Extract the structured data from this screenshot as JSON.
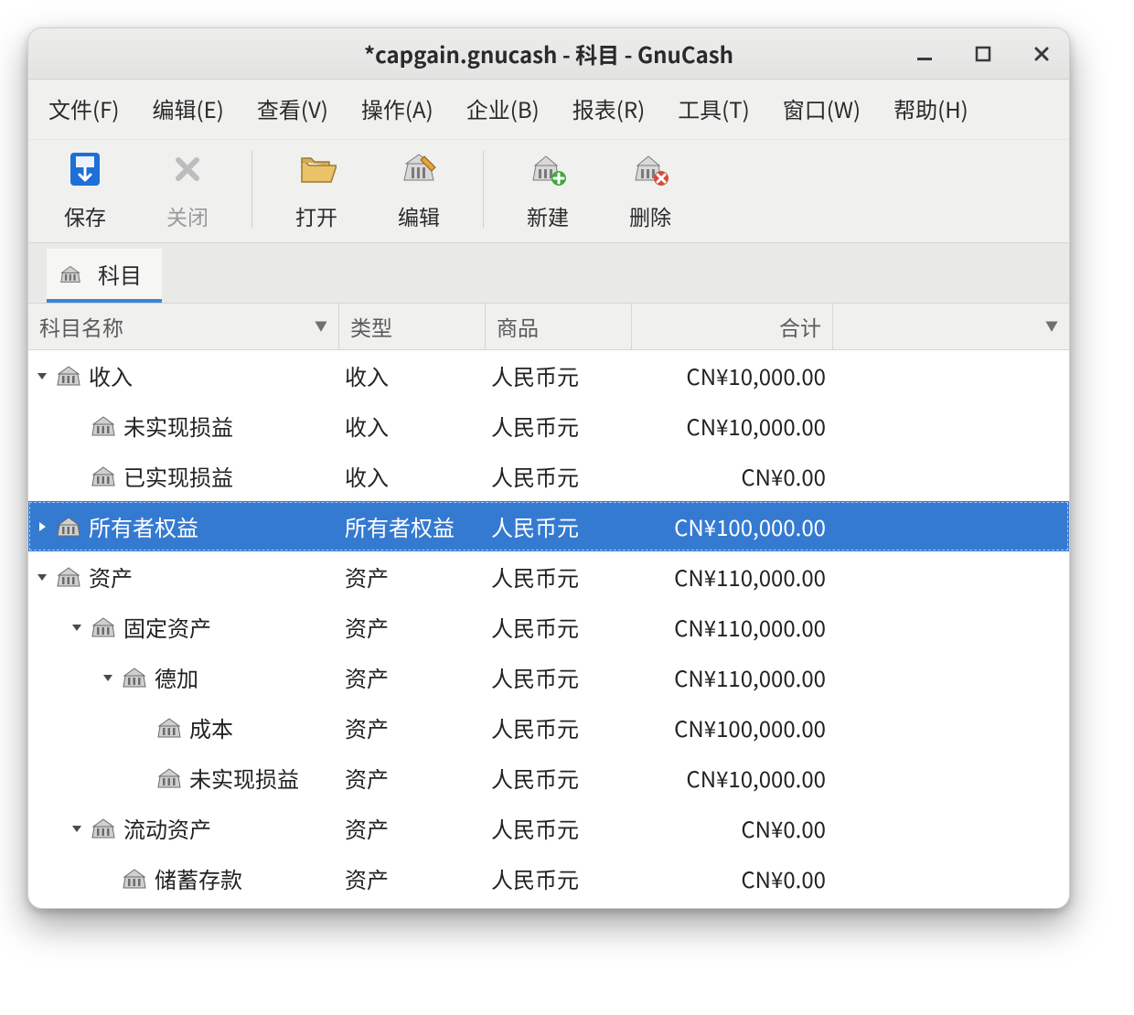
{
  "window": {
    "title": "*capgain.gnucash - 科目 - GnuCash"
  },
  "menu": {
    "file": "文件(F)",
    "edit": "编辑(E)",
    "view": "查看(V)",
    "action": "操作(A)",
    "biz": "企业(B)",
    "report": "报表(R)",
    "tools": "工具(T)",
    "window": "窗口(W)",
    "help": "帮助(H)"
  },
  "toolbar": {
    "save": "保存",
    "close": "关闭",
    "open": "打开",
    "edit": "编辑",
    "new": "新建",
    "delete": "删除"
  },
  "tabs": {
    "accounts": "科目"
  },
  "columns": {
    "name": "科目名称",
    "type": "类型",
    "commodity": "商品",
    "total": "合计"
  },
  "rows": [
    {
      "indent": 0,
      "exp": "down",
      "name": "收入",
      "type": "收入",
      "commodity": "人民币元",
      "total": "CN¥10,000.00",
      "selected": false
    },
    {
      "indent": 1,
      "exp": "none",
      "name": "未实现损益",
      "type": "收入",
      "commodity": "人民币元",
      "total": "CN¥10,000.00",
      "selected": false
    },
    {
      "indent": 1,
      "exp": "none",
      "name": "已实现损益",
      "type": "收入",
      "commodity": "人民币元",
      "total": "CN¥0.00",
      "selected": false
    },
    {
      "indent": 0,
      "exp": "right",
      "name": "所有者权益",
      "type": "所有者权益",
      "commodity": "人民币元",
      "total": "CN¥100,000.00",
      "selected": true
    },
    {
      "indent": 0,
      "exp": "down",
      "name": "资产",
      "type": "资产",
      "commodity": "人民币元",
      "total": "CN¥110,000.00",
      "selected": false
    },
    {
      "indent": 1,
      "exp": "down",
      "name": "固定资产",
      "type": "资产",
      "commodity": "人民币元",
      "total": "CN¥110,000.00",
      "selected": false
    },
    {
      "indent": 2,
      "exp": "down",
      "name": "德加",
      "type": "资产",
      "commodity": "人民币元",
      "total": "CN¥110,000.00",
      "selected": false
    },
    {
      "indent": 3,
      "exp": "none",
      "name": "成本",
      "type": "资产",
      "commodity": "人民币元",
      "total": "CN¥100,000.00",
      "selected": false
    },
    {
      "indent": 3,
      "exp": "none",
      "name": "未实现损益",
      "type": "资产",
      "commodity": "人民币元",
      "total": "CN¥10,000.00",
      "selected": false
    },
    {
      "indent": 1,
      "exp": "down",
      "name": "流动资产",
      "type": "资产",
      "commodity": "人民币元",
      "total": "CN¥0.00",
      "selected": false
    },
    {
      "indent": 2,
      "exp": "none",
      "name": "储蓄存款",
      "type": "资产",
      "commodity": "人民币元",
      "total": "CN¥0.00",
      "selected": false
    }
  ]
}
